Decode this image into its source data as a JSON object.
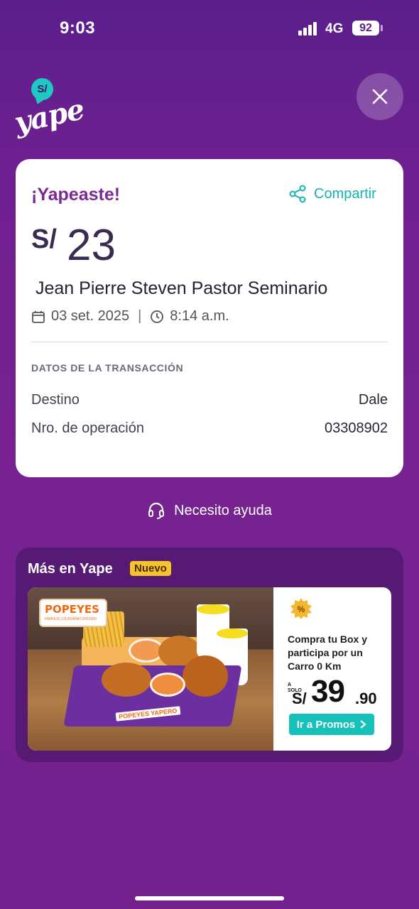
{
  "status_bar": {
    "time": "9:03",
    "network": "4G",
    "battery": "92"
  },
  "logo": {
    "bubble": "S/",
    "word": "yape"
  },
  "card": {
    "title": "¡Yapeaste!",
    "share_label": "Compartir",
    "currency": "S/",
    "amount": "23",
    "recipient": "Jean Pierre Steven Pastor Seminario",
    "date": "03 set. 2025",
    "time": "8:14 a.m.",
    "section_title": "DATOS DE LA TRANSACCIÓN",
    "rows": [
      {
        "label": "Destino",
        "value": "Dale"
      },
      {
        "label": "Nro. de operación",
        "value": "03308902"
      }
    ]
  },
  "help": {
    "label": "Necesito ayuda"
  },
  "more": {
    "title": "Más en Yape",
    "badge": "Nuevo",
    "promo": {
      "brand": "POPEYES",
      "brand_sub": "FAMOUS LOUISIANA CHICKEN",
      "box_label": "POPEYES YAPERO",
      "text": "Compra tu Box y participa por un Carro 0 Km",
      "price_prefix": "A SOLO",
      "price_currency": "S/",
      "price_int": "39",
      "price_dec": ".90",
      "button": "Ir a Promos"
    }
  },
  "colors": {
    "background": "#6e2090",
    "accent_teal": "#15b4ae",
    "title_purple": "#7b2a93",
    "badge_yellow": "#f5c32c"
  }
}
